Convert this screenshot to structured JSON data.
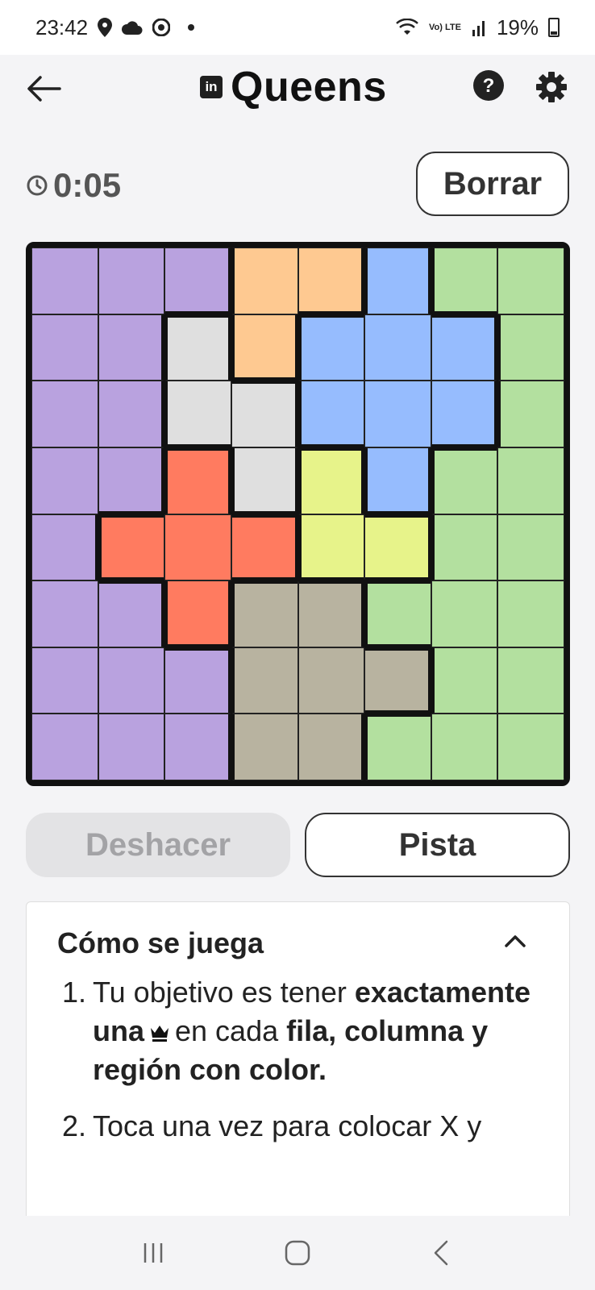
{
  "status_bar": {
    "time": "23:42",
    "network_label": "Vo) LTE",
    "battery": "19%"
  },
  "header": {
    "logo": "in",
    "title": "Queens"
  },
  "timer": {
    "value": "0:05"
  },
  "actions": {
    "clear_label": "Borrar",
    "undo_label": "Deshacer",
    "hint_label": "Pista"
  },
  "colors": {
    "purple": "#b9a2df",
    "orange": "#fec991",
    "blue": "#96bcfe",
    "green": "#b3e09f",
    "gray": "#dfdfdf",
    "red": "#ff7b60",
    "yellow": "#e7f38a",
    "tan": "#b8b3a0"
  },
  "board": {
    "size": 8,
    "regions": [
      [
        "purple",
        "purple",
        "purple",
        "orange",
        "orange",
        "blue",
        "green",
        "green"
      ],
      [
        "purple",
        "purple",
        "gray",
        "orange",
        "blue",
        "blue",
        "blue",
        "green"
      ],
      [
        "purple",
        "purple",
        "gray",
        "gray",
        "blue",
        "blue",
        "blue",
        "green"
      ],
      [
        "purple",
        "purple",
        "red",
        "gray",
        "yellow",
        "blue",
        "green",
        "green"
      ],
      [
        "purple",
        "red",
        "red",
        "red",
        "yellow",
        "yellow",
        "green",
        "green"
      ],
      [
        "purple",
        "purple",
        "red",
        "tan",
        "tan",
        "green",
        "green",
        "green"
      ],
      [
        "purple",
        "purple",
        "purple",
        "tan",
        "tan",
        "tan",
        "green",
        "green"
      ],
      [
        "purple",
        "purple",
        "purple",
        "tan",
        "tan",
        "green",
        "green",
        "green"
      ]
    ]
  },
  "how_to_play": {
    "title": "Cómo se juega",
    "rules": [
      {
        "num": "1.",
        "part1": "Tu objetivo es tener",
        "bold1": "exactamente una",
        "part2": "en cada",
        "bold2": "fila, columna y región con color."
      },
      {
        "num": "2.",
        "text": "Toca una vez para colocar X y"
      }
    ]
  }
}
